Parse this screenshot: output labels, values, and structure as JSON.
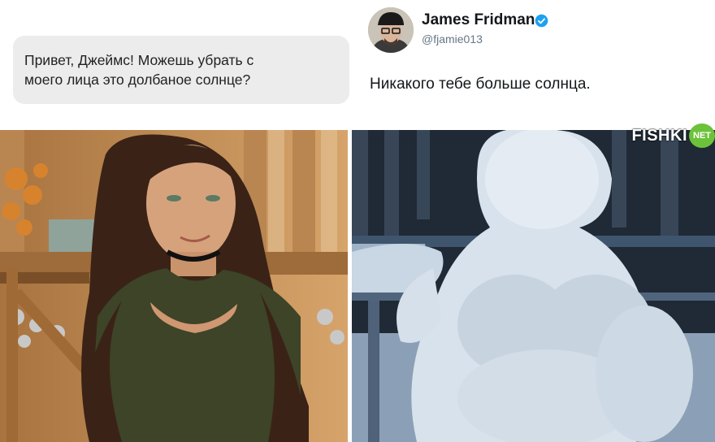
{
  "message": {
    "line1": "Привет, Джеймс! Можешь убрать с",
    "line2": "моего лица это долбаное солнце?"
  },
  "tweet": {
    "author_name": "James Fridman",
    "handle": "@fjamie013",
    "text": "Никакого тебе больше солнца.",
    "verified_icon": "verified-badge-icon",
    "verified_color": "#1da1f2"
  },
  "watermark": {
    "text": "FISHKI",
    "badge": "NET",
    "badge_color": "#6cc23a"
  },
  "images": {
    "left": "original-photo",
    "right": "snowman-edit"
  }
}
